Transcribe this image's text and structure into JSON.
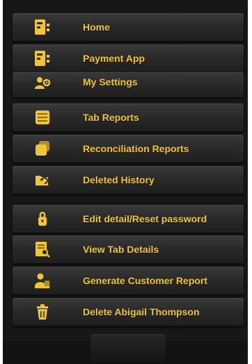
{
  "colors": {
    "accent": "#f0c437",
    "background": "#171717",
    "item_background": "#2a2a2a"
  },
  "menu": {
    "items": [
      {
        "label": "Home",
        "icon": "id-card-icon"
      },
      {
        "label": "Payment App",
        "icon": "id-card-icon"
      },
      {
        "label": "My Settings",
        "icon": "user-gear-icon"
      },
      {
        "label": "Tab Reports",
        "icon": "list-report-icon"
      },
      {
        "label": "Reconciliation Reports",
        "icon": "stacked-pages-icon"
      },
      {
        "label": "Deleted History",
        "icon": "undo-folder-icon"
      },
      {
        "label": "Edit detail/Reset password",
        "icon": "user-lock-icon"
      },
      {
        "label": "View Tab Details",
        "icon": "document-search-icon"
      },
      {
        "label": "Generate Customer Report",
        "icon": "user-stamp-icon"
      },
      {
        "label": "Delete Abigail Thompson",
        "icon": "trash-icon"
      }
    ]
  }
}
